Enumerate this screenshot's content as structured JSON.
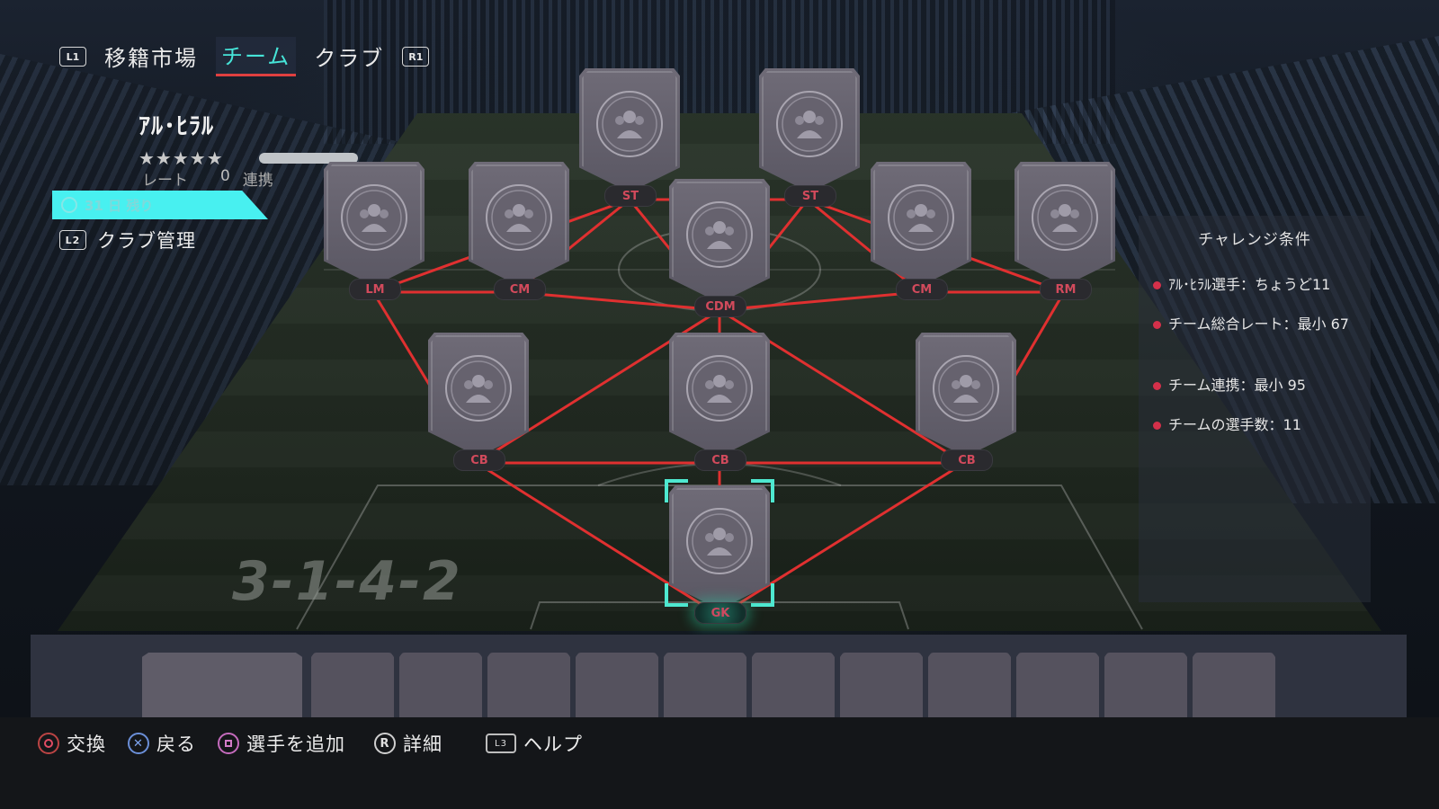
{
  "nav": {
    "l1": "L1",
    "r1": "R1",
    "tabs": [
      {
        "label": "移籍市場",
        "active": false
      },
      {
        "label": "チーム",
        "active": true
      },
      {
        "label": "クラブ",
        "active": false
      }
    ]
  },
  "club": {
    "name": "ｱﾙ･ﾋﾗﾙ",
    "stars": "★★★★★",
    "rating_label": "レート",
    "rating_value": "0",
    "chemistry_label": "連携",
    "timer": "31 日 残り",
    "management_button": "L2",
    "management_label": "クラブ管理"
  },
  "formation": "3-1-4-2",
  "positions": {
    "st1": "ST",
    "st2": "ST",
    "lm": "LM",
    "cm1": "CM",
    "cdm": "CDM",
    "cm2": "CM",
    "rm": "RM",
    "cb1": "CB",
    "cb2": "CB",
    "cb3": "CB",
    "gk": "GK"
  },
  "challenge": {
    "title": "チャレンジ条件",
    "conditions": [
      "ｱﾙ･ﾋﾗﾙ選手：ちょうど11",
      "チーム総合レート：最小 67",
      "チーム連携：最小 95",
      "チームの選手数：11"
    ]
  },
  "footer": {
    "swap": "交換",
    "back": "戻る",
    "add_player": "選手を追加",
    "details": "詳細",
    "help": "ヘルプ",
    "r_label": "R",
    "l3_label": "L3"
  },
  "colors": {
    "accent": "#46e4d8",
    "link_line": "#e03030",
    "position_text": "#d24a5c",
    "card": "#6f6b77"
  }
}
